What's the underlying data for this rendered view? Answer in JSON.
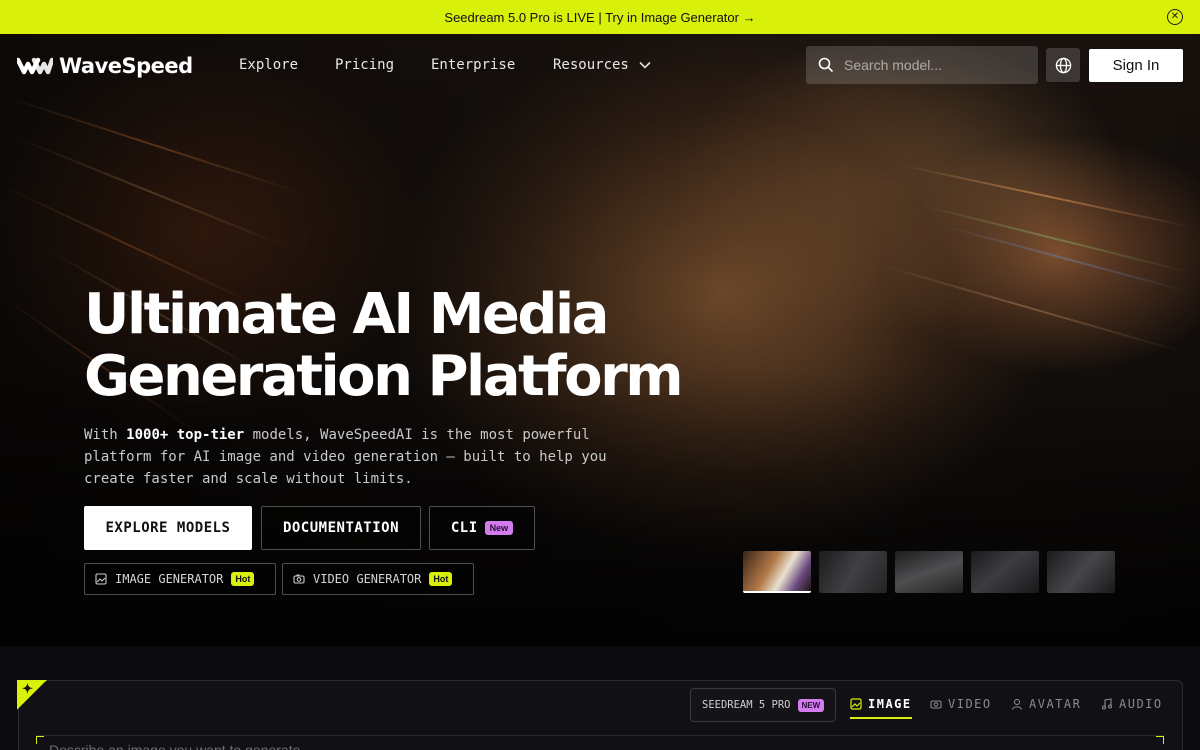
{
  "announcement": {
    "text": "Seedream 5.0 Pro is LIVE | Try in Image Generator →",
    "close_icon": "close-circle-icon"
  },
  "nav": {
    "brand": "WaveSpeed",
    "links": [
      "Explore",
      "Pricing",
      "Enterprise",
      "Resources"
    ],
    "search_placeholder": "Search model...",
    "signin_label": "Sign In"
  },
  "hero": {
    "headline_line1": "Ultimate AI Media",
    "headline_line2": "Generation Platform",
    "sub_prefix": "With ",
    "sub_bold": "1000+ top-tier",
    "sub_suffix": " models, WaveSpeedAI is the most powerful platform for AI image and video generation — built to help you create faster and scale without limits.",
    "buttons": {
      "explore": "EXPLORE MODELS",
      "docs": "DOCUMENTATION",
      "cli": "CLI",
      "cli_badge": "New"
    },
    "chips": [
      {
        "label": "IMAGE GENERATOR",
        "badge": "Hot"
      },
      {
        "label": "VIDEO GENERATOR",
        "badge": "Hot"
      }
    ],
    "active_thumbnail": 1,
    "thumbnail_count": 5
  },
  "generator": {
    "model_label": "SEEDREAM 5 PRO",
    "model_badge": "NEW",
    "tabs": [
      "IMAGE",
      "VIDEO",
      "AVATAR",
      "AUDIO"
    ],
    "active_tab": "IMAGE",
    "prompt_placeholder": "Describe an image you want to generate..."
  },
  "colors": {
    "accent": "#d8f00a",
    "badge_new": "#d27cf0",
    "background": "#0b0a0d"
  }
}
